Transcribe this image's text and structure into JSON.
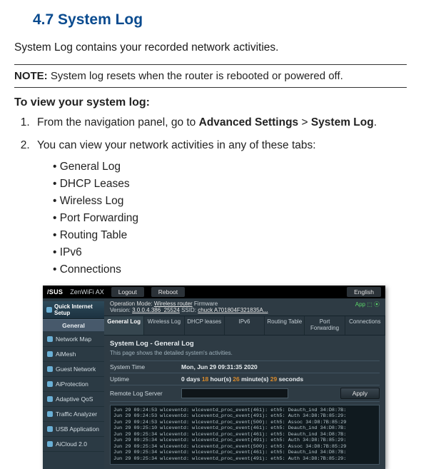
{
  "heading": "4.7    System Log",
  "intro": "System Log contains your recorded network activities.",
  "note_label": "NOTE:",
  "note_text": "  System log resets when the router is rebooted or powered off.",
  "sub_heading": "To view your system log:",
  "step1_a": "From the navigation panel, go to ",
  "step1_b": "Advanced Settings",
  "step1_c": " > ",
  "step1_d": "System Log",
  "step1_e": ".",
  "step2": "You can view your network activities in any of these tabs:",
  "tabs_list": {
    "0": "General Log",
    "1": "DHCP Leases",
    "2": "Wireless Log",
    "3": "Port Forwarding",
    "4": "Routing Table",
    "5": "IPv6",
    "6": "Connections"
  },
  "ss": {
    "brand": "/SUS",
    "product": "ZenWiFi AX",
    "btn_logout": "Logout",
    "btn_reboot": "Reboot",
    "lang": "English",
    "opmode_label": "Operation Mode: ",
    "opmode_value": "Wireless router",
    "fw_label": "  Firmware",
    "version_label": "Version: ",
    "version_value": "3.0.0.4.386_25524",
    "ssid_label": "  SSID: ",
    "ssid_value": "chuck  A701804F321835A...",
    "app_label": "App",
    "qis": "Quick Internet Setup",
    "cat_general": "General",
    "nav": {
      "0": "Network Map",
      "1": "AiMesh",
      "2": "Guest Network",
      "3": "AiProtection",
      "4": "Adaptive QoS",
      "5": "Traffic Analyzer",
      "6": "USB Application",
      "7": "AiCloud 2.0"
    },
    "tabs": {
      "0": "General Log",
      "1": "Wireless Log",
      "2": "DHCP leases",
      "3": "IPv6",
      "4": "Routing Table",
      "5": "Port Forwarding",
      "6": "Connections"
    },
    "page_title": "System Log - General Log",
    "page_desc": "This page shows the detailed system's activities.",
    "row_time_lbl": "System Time",
    "row_time_val": "Mon, Jun 29 09:31:35 2020",
    "row_uptime_lbl": "Uptime",
    "row_uptime_a": "0 days ",
    "row_uptime_b": "18",
    "row_uptime_c": " hour(s) ",
    "row_uptime_d": "26",
    "row_uptime_e": " minute(s) ",
    "row_uptime_f": "29",
    "row_uptime_g": " seconds",
    "row_remote_lbl": "Remote Log Server",
    "apply": "Apply",
    "log_text": "Jun 29 09:24:53 wlceventd: wlceventd_proc_event(461): eth5: Deauth_ind 34:D8:7B:\nJun 29 09:24:53 wlceventd: wlceventd_proc_event(491): eth5: Auth 34:D8:7B:85:29:\nJun 29 09:24:53 wlceventd: wlceventd_proc_event(500): eth5: Assoc 34:D8:7B:85:29\nJun 29 09:25:10 wlceventd: wlceventd_proc_event(461): eth5: Deauth_ind 34:D8:7B:\nJun 29 09:25:34 wlceventd: wlceventd_proc_event(461): eth5: Deauth_ind 34:D8:7B:\nJun 29 09:25:34 wlceventd: wlceventd_proc_event(491): eth5: Auth 34:D8:7B:85:29:\nJun 29 09:25:34 wlceventd: wlceventd_proc_event(500): eth5: Assoc 34:D8:7B:85:29\nJun 29 09:25:34 wlceventd: wlceventd_proc_event(461): eth5: Deauth_ind 34:D8:7B:\nJun 29 09:25:34 wlceventd: wlceventd_proc_event(491): eth5: Auth 34:D8:7B:85:29:"
  }
}
